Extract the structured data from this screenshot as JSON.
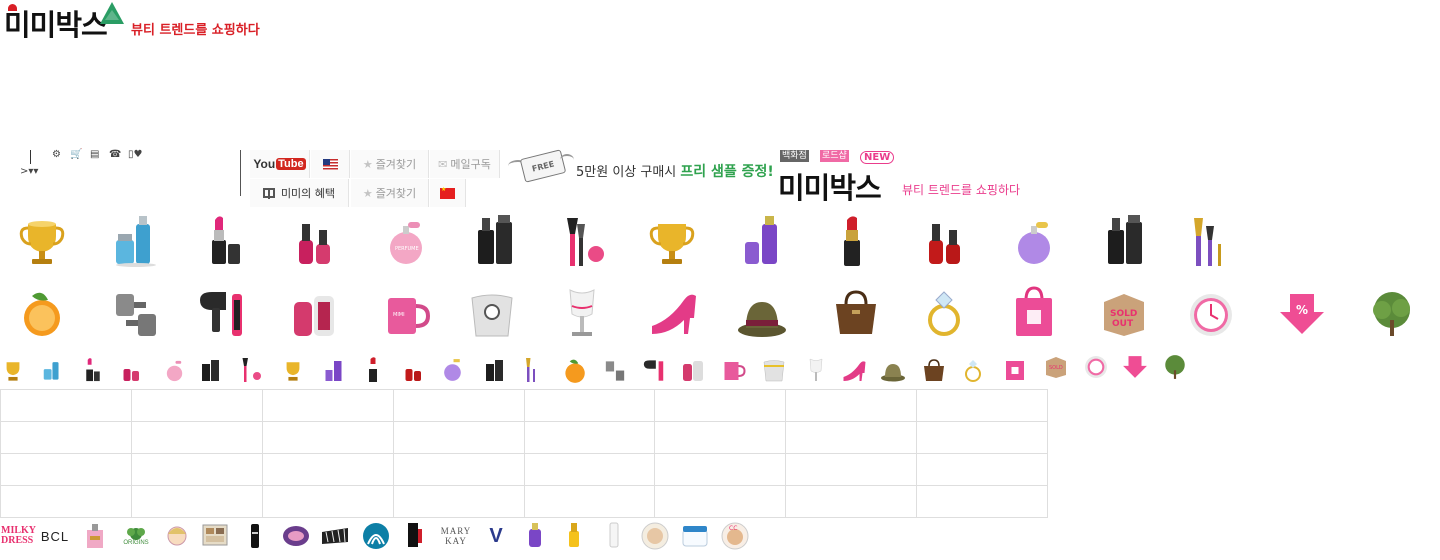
{
  "logo": {
    "word": "미미박스",
    "tagline": "뷰티 트렌드를 쇼핑하다"
  },
  "mini_toolbar": {
    "row1_icons": [
      "⚙",
      "🛒",
      "▤",
      "☎",
      "▯♥"
    ],
    "row2": ">▾▾"
  },
  "topbar": {
    "youtube": {
      "you": "You",
      "tube": "Tube"
    },
    "favorite_label": "즐겨찾기",
    "mail_label": "메일구독",
    "benefit_label": "미미의 혜택"
  },
  "free_banner": {
    "free_tag": "FREE",
    "text": "5만원 이상 구매시 ",
    "highlight": "프리 샘플 증정!"
  },
  "brand2": {
    "badge1": "백화점",
    "badge2": "로드샵",
    "badge3": "NEW",
    "word": "미미박스",
    "tagline": "뷰티 트렌드를 쇼핑하다"
  },
  "brand_logos": {
    "milky": "MILKY DRESS",
    "bcl": "BCL",
    "origins": "ORIGINS",
    "mary": "MARY KAY",
    "v": "V"
  },
  "colors": {
    "accent_red": "#d91f26",
    "accent_pink": "#ea3c8c",
    "accent_green": "#2fa24e"
  }
}
